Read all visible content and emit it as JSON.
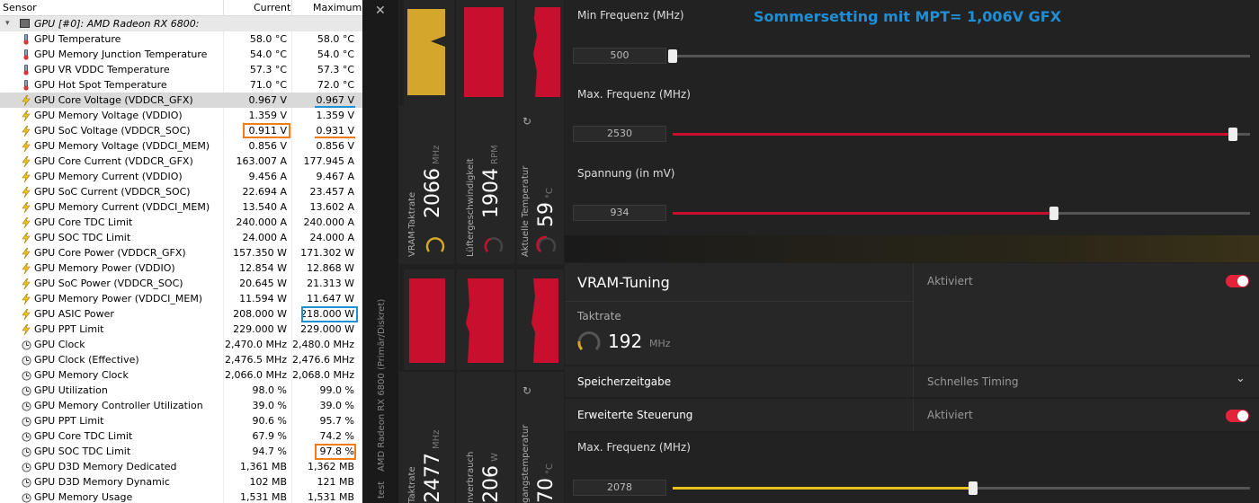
{
  "hwinfo": {
    "headers": {
      "sensor": "Sensor",
      "current": "Current",
      "maximum": "Maximum"
    },
    "group_label": "GPU [#0]: AMD Radeon RX 6800:",
    "rows": [
      {
        "icon": "thermometer-icon",
        "name": "GPU Temperature",
        "current": "58.0 °C",
        "max": "58.0 °C"
      },
      {
        "icon": "thermometer-icon",
        "name": "GPU Memory Junction Temperature",
        "current": "54.0 °C",
        "max": "54.0 °C"
      },
      {
        "icon": "thermometer-icon",
        "name": "GPU VR VDDC Temperature",
        "current": "57.3 °C",
        "max": "57.3 °C"
      },
      {
        "icon": "thermometer-icon",
        "name": "GPU Hot Spot Temperature",
        "current": "71.0 °C",
        "max": "72.0 °C"
      },
      {
        "icon": "lightning-icon",
        "name": "GPU Core Voltage (VDDCR_GFX)",
        "current": "0.967 V",
        "max": "0.967 V"
      },
      {
        "icon": "lightning-icon",
        "name": "GPU Memory Voltage (VDDIO)",
        "current": "1.359 V",
        "max": "1.359 V"
      },
      {
        "icon": "lightning-icon",
        "name": "GPU SoC Voltage (VDDCR_SOC)",
        "current": "0.911 V",
        "max": "0.931 V"
      },
      {
        "icon": "lightning-icon",
        "name": "GPU Memory Voltage (VDDCI_MEM)",
        "current": "0.856 V",
        "max": "0.856 V"
      },
      {
        "icon": "lightning-icon",
        "name": "GPU Core Current (VDDCR_GFX)",
        "current": "163.007 A",
        "max": "177.945 A"
      },
      {
        "icon": "lightning-icon",
        "name": "GPU Memory Current (VDDIO)",
        "current": "9.456 A",
        "max": "9.467 A"
      },
      {
        "icon": "lightning-icon",
        "name": "GPU SoC Current (VDDCR_SOC)",
        "current": "22.694 A",
        "max": "23.457 A"
      },
      {
        "icon": "lightning-icon",
        "name": "GPU Memory Current (VDDCI_MEM)",
        "current": "13.540 A",
        "max": "13.602 A"
      },
      {
        "icon": "lightning-icon",
        "name": "GPU Core TDC Limit",
        "current": "240.000 A",
        "max": "240.000 A"
      },
      {
        "icon": "lightning-icon",
        "name": "GPU SOC TDC Limit",
        "current": "24.000 A",
        "max": "24.000 A"
      },
      {
        "icon": "lightning-icon",
        "name": "GPU Core Power (VDDCR_GFX)",
        "current": "157.350 W",
        "max": "171.302 W"
      },
      {
        "icon": "lightning-icon",
        "name": "GPU Memory Power (VDDIO)",
        "current": "12.854 W",
        "max": "12.868 W"
      },
      {
        "icon": "lightning-icon",
        "name": "GPU SoC Power (VDDCR_SOC)",
        "current": "20.645 W",
        "max": "21.313 W"
      },
      {
        "icon": "lightning-icon",
        "name": "GPU Memory Power (VDDCI_MEM)",
        "current": "11.594 W",
        "max": "11.647 W"
      },
      {
        "icon": "lightning-icon",
        "name": "GPU ASIC Power",
        "current": "208.000 W",
        "max": "218.000 W"
      },
      {
        "icon": "lightning-icon",
        "name": "GPU PPT Limit",
        "current": "229.000 W",
        "max": "229.000 W"
      },
      {
        "icon": "clock-icon",
        "name": "GPU Clock",
        "current": "2,470.0 MHz",
        "max": "2,480.0 MHz"
      },
      {
        "icon": "clock-icon",
        "name": "GPU Clock (Effective)",
        "current": "2,476.5 MHz",
        "max": "2,476.6 MHz"
      },
      {
        "icon": "clock-icon",
        "name": "GPU Memory Clock",
        "current": "2,066.0 MHz",
        "max": "2,068.0 MHz"
      },
      {
        "icon": "clock-icon",
        "name": "GPU Utilization",
        "current": "98.0 %",
        "max": "99.0 %"
      },
      {
        "icon": "clock-icon",
        "name": "GPU Memory Controller Utilization",
        "current": "39.0 %",
        "max": "39.0 %"
      },
      {
        "icon": "clock-icon",
        "name": "GPU PPT Limit",
        "current": "90.6 %",
        "max": "95.7 %"
      },
      {
        "icon": "clock-icon",
        "name": "GPU Core TDC Limit",
        "current": "67.9 %",
        "max": "74.2 %"
      },
      {
        "icon": "clock-icon",
        "name": "GPU SOC TDC Limit",
        "current": "94.7 %",
        "max": "97.8 %"
      },
      {
        "icon": "clock-icon",
        "name": "GPU D3D Memory Dedicated",
        "current": "1,361 MB",
        "max": "1,362 MB"
      },
      {
        "icon": "clock-icon",
        "name": "GPU D3D Memory Dynamic",
        "current": "102 MB",
        "max": "121 MB"
      },
      {
        "icon": "clock-icon",
        "name": "GPU Memory Usage",
        "current": "1,531 MB",
        "max": "1,531 MB"
      }
    ],
    "highlight_colors": {
      "blue": "#1e90d6",
      "orange": "#f07c1a"
    }
  },
  "amd": {
    "close_glyph": "✕",
    "device_label": "AMD Radeon RX 6800 (Primär/Diskret)",
    "device_label_tail": "test",
    "banner": "Sommersetting mit MPT= 1,006V GFX",
    "banner_color": "#1e8fd6",
    "accent_red": "#c8102e",
    "accent_yellow": "#d4a72c",
    "tiles_top": [
      {
        "label": "VRAM-Taktrate",
        "value": "2066",
        "unit": "MHz",
        "color": "#d4a72c"
      },
      {
        "label": "Lüftergeschwindigkeit",
        "value": "1904",
        "unit": "RPM",
        "color": "#c8102e"
      },
      {
        "label": "Aktuelle Temperatur",
        "value": "59",
        "unit": "°C",
        "color": "#c8102e"
      }
    ],
    "tiles_bottom": [
      {
        "label": "Taktrate",
        "value": "2477",
        "unit": "MHz",
        "color": "#c8102e"
      },
      {
        "label": "nverbrauch",
        "value": "206",
        "unit": "W",
        "color": "#c8102e"
      },
      {
        "label": "gangstemperatur",
        "value": "70",
        "unit": "°C",
        "color": "#c8102e"
      }
    ],
    "min_freq": {
      "title": "Min Frequenz (MHz)",
      "value": "500",
      "fraction": 0.0
    },
    "max_freq": {
      "title": "Max. Frequenz (MHz)",
      "value": "2530",
      "fraction": 0.97
    },
    "voltage": {
      "title": "Spannung (in mV)",
      "value": "934",
      "fraction": 0.66
    },
    "vram_tuning": {
      "title": "VRAM-Tuning",
      "state": "Aktiviert"
    },
    "taktrate": {
      "label": "Taktrate",
      "value": "192",
      "unit": "MHz"
    },
    "memory_timing": {
      "label": "Speicherzeitgabe",
      "value": "Schnelles Timing"
    },
    "advanced_control": {
      "label": "Erweiterte Steuerung",
      "state": "Aktiviert"
    },
    "vram_max_freq": {
      "title": "Max. Frequenz (MHz)",
      "value": "2078",
      "fraction": 0.52
    }
  }
}
